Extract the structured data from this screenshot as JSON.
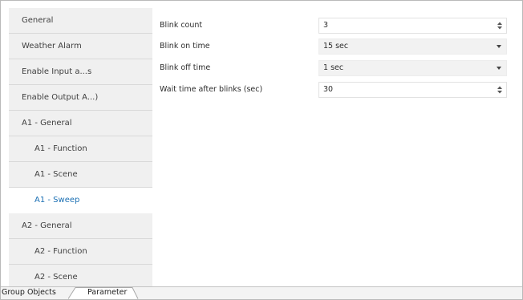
{
  "sidebar": {
    "items": [
      {
        "label": "General",
        "indent": false,
        "active": false
      },
      {
        "label": "Weather Alarm",
        "indent": false,
        "active": false
      },
      {
        "label": "Enable Input a...s",
        "indent": false,
        "active": false
      },
      {
        "label": "Enable Output A...)",
        "indent": false,
        "active": false
      },
      {
        "label": "A1 - General",
        "indent": false,
        "active": false
      },
      {
        "label": "A1 - Function",
        "indent": true,
        "active": false
      },
      {
        "label": "A1 - Scene",
        "indent": true,
        "active": false
      },
      {
        "label": "A1 - Sweep",
        "indent": true,
        "active": true
      },
      {
        "label": "A2 - General",
        "indent": false,
        "active": false
      },
      {
        "label": "A2 - Function",
        "indent": true,
        "active": false
      },
      {
        "label": "A2 - Scene",
        "indent": true,
        "active": false
      }
    ]
  },
  "params": [
    {
      "label": "Blink count",
      "value": "3",
      "control": "spinner"
    },
    {
      "label": "Blink on time",
      "value": "15 sec",
      "control": "dropdown"
    },
    {
      "label": "Blink off time",
      "value": "1 sec",
      "control": "dropdown"
    },
    {
      "label": "Wait time after blinks (sec)",
      "value": "30",
      "control": "spinner"
    }
  ],
  "tabs": {
    "group_objects": "Group Objects",
    "parameter": "Parameter"
  },
  "colors": {
    "active_item_text": "#1a6fb3",
    "sidebar_bg": "#f0f0f0"
  }
}
